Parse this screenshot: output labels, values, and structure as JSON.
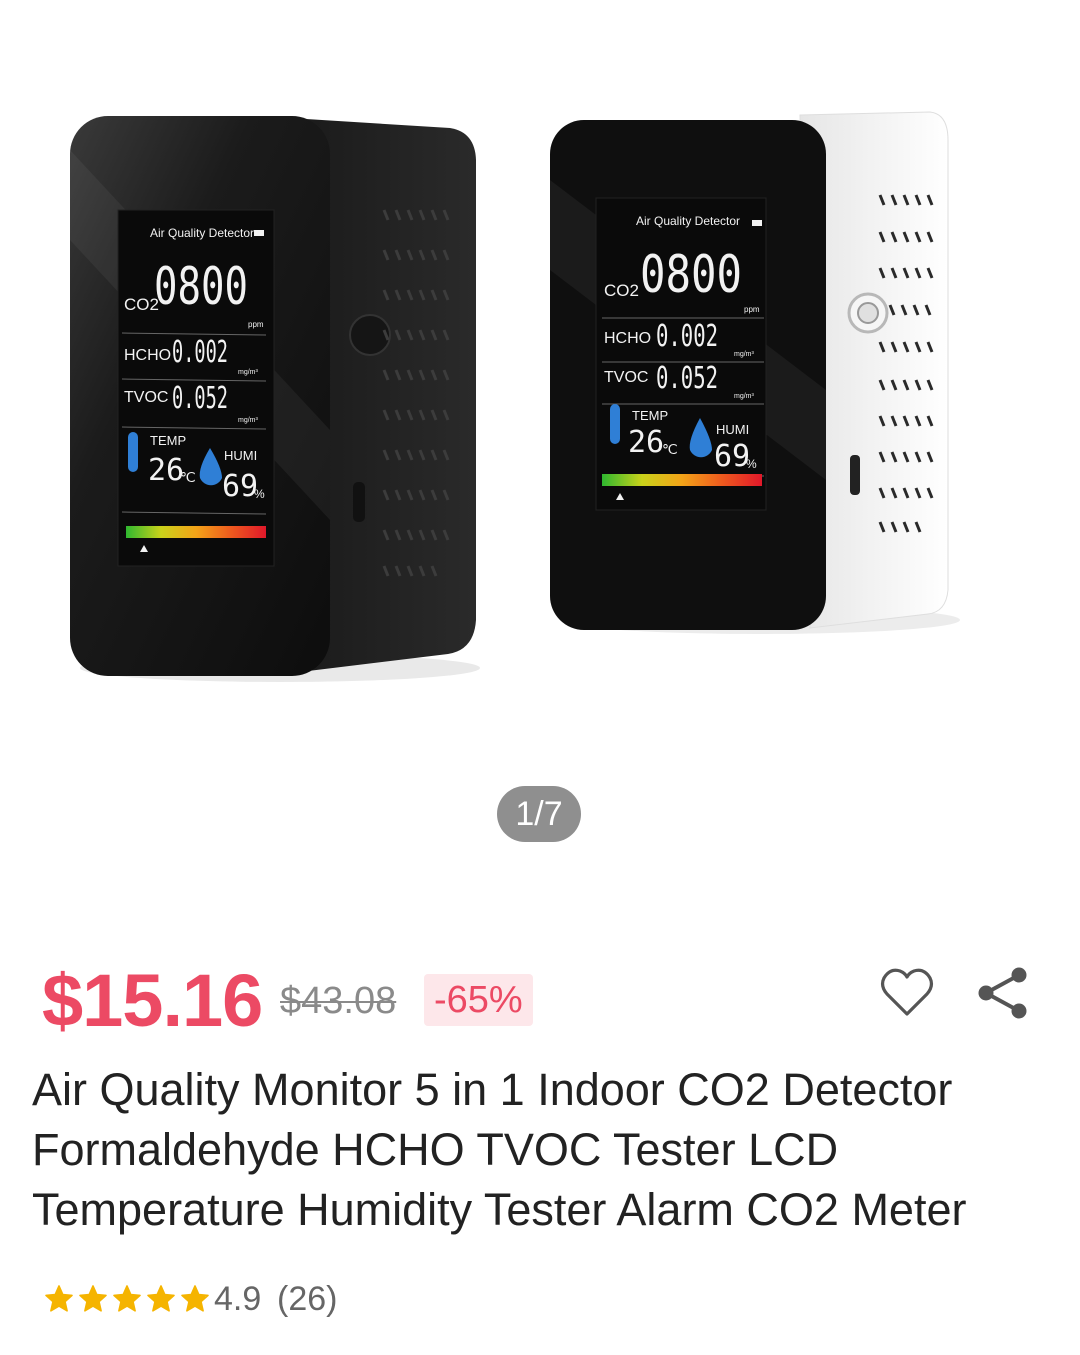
{
  "gallery": {
    "page_indicator": "1/7",
    "devices": [
      {
        "finish": "black",
        "header": "Air Quality Detector",
        "co2_label": "CO2",
        "co2_value": "0800",
        "co2_unit": "ppm",
        "hcho_label": "HCHO",
        "hcho_value": "0.002",
        "hcho_unit": "mg/m³",
        "tvoc_label": "TVOC",
        "tvoc_value": "0.052",
        "tvoc_unit": "mg/m³",
        "temp_label": "TEMP",
        "temp_value": "26",
        "temp_unit": "℃",
        "humi_label": "HUMI",
        "humi_value": "69",
        "humi_unit": "%"
      },
      {
        "finish": "white",
        "header": "Air Quality Detector",
        "co2_label": "CO2",
        "co2_value": "0800",
        "co2_unit": "ppm",
        "hcho_label": "HCHO",
        "hcho_value": "0.002",
        "hcho_unit": "mg/m³",
        "tvoc_label": "TVOC",
        "tvoc_value": "0.052",
        "tvoc_unit": "mg/m³",
        "temp_label": "TEMP",
        "temp_value": "26",
        "temp_unit": "℃",
        "humi_label": "HUMI",
        "humi_value": "69",
        "humi_unit": "%"
      }
    ]
  },
  "product": {
    "price": "$15.16",
    "original_price": "$43.08",
    "discount": "-65%",
    "title": "Air Quality Monitor 5 in 1 Indoor CO2 Detector Formaldehyde HCHO TVOC Tester LCD Temperature Humidity Tester Alarm CO2 Meter",
    "rating": "4.9",
    "rating_fraction": 0.98,
    "review_count": "(26)"
  },
  "icons": {
    "favorite": "heart-outline-icon",
    "share": "share-icon",
    "star": "star-icon"
  },
  "colors": {
    "price": "#ec4a64",
    "discount_bg": "#fde7ea",
    "star": "#f5b400",
    "indicator_bg": "#8f8f8f"
  }
}
